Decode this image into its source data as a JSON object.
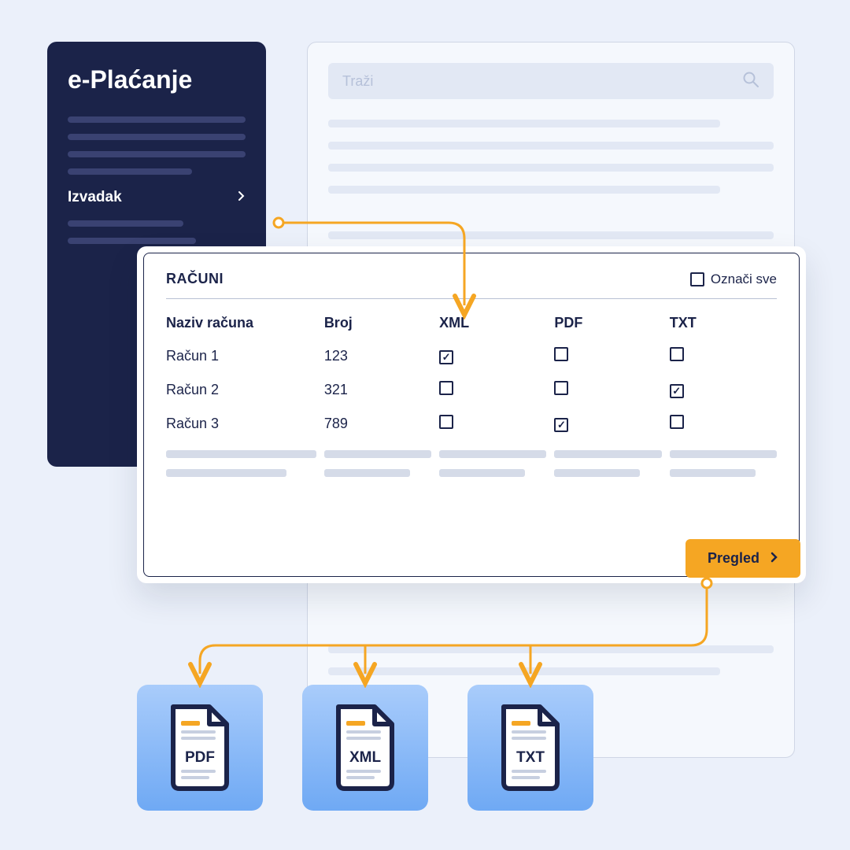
{
  "sidebar": {
    "title": "e-Plaćanje",
    "active_item": "Izvadak"
  },
  "search": {
    "placeholder": "Traži"
  },
  "modal": {
    "title": "RAČUNI",
    "select_all_label": "Označi sve",
    "columns": {
      "name": "Naziv računa",
      "number": "Broj",
      "xml": "XML",
      "pdf": "PDF",
      "txt": "TXT"
    },
    "rows": [
      {
        "name": "Račun 1",
        "number": "123",
        "xml": true,
        "pdf": false,
        "txt": false
      },
      {
        "name": "Račun 2",
        "number": "321",
        "xml": false,
        "pdf": false,
        "txt": true
      },
      {
        "name": "Račun 3",
        "number": "789",
        "xml": false,
        "pdf": true,
        "txt": false
      }
    ],
    "button": "Pregled"
  },
  "files": {
    "pdf": "PDF",
    "xml": "XML",
    "txt": "TXT"
  },
  "colors": {
    "accent": "#F5A623",
    "dark": "#1B2349"
  }
}
